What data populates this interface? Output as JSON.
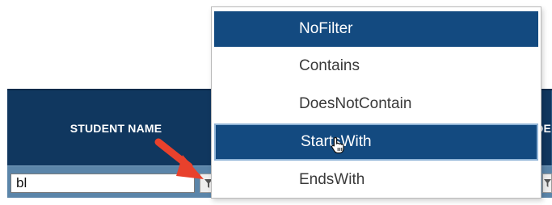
{
  "grid": {
    "columns": [
      {
        "header": "STUDENT NAME"
      },
      {
        "header": ""
      },
      {
        "header": ""
      },
      {
        "header": ""
      },
      {
        "header": "DE"
      }
    ],
    "filter_value": "bl"
  },
  "filter_menu": {
    "options": [
      "NoFilter",
      "Contains",
      "DoesNotContain",
      "StartsWith",
      "EndsWith"
    ],
    "selected": "NoFilter",
    "hovered": "StartsWith"
  },
  "colors": {
    "header_bg": "#10375f",
    "filter_row_bg": "#5b85a9",
    "menu_highlight": "#134a80",
    "annotation_arrow": "#e8412c"
  },
  "icons": {
    "filter": "funnel-icon",
    "cursor": "hand-pointer-icon",
    "annotation": "red-arrow"
  }
}
